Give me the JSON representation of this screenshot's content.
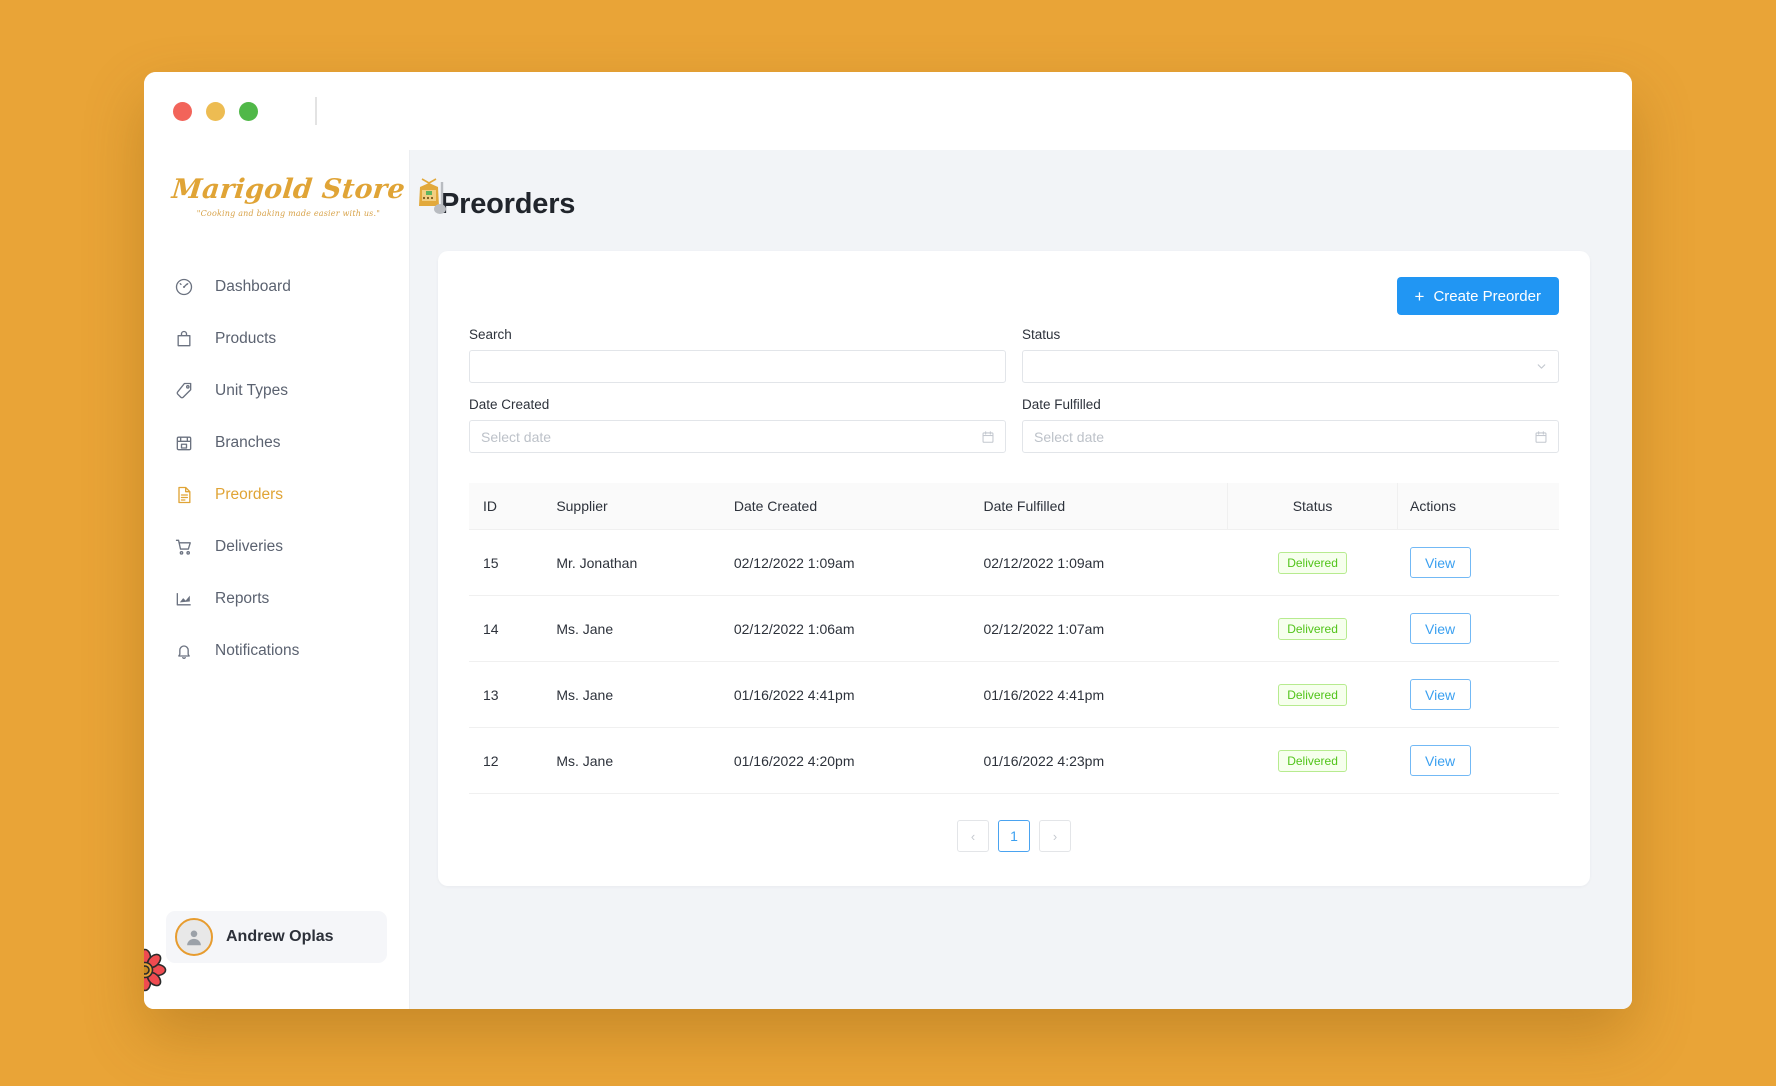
{
  "window": {
    "traffic_lights": [
      "close",
      "minimize",
      "maximize"
    ]
  },
  "sidebar": {
    "logo": {
      "name": "Marigold Store",
      "tagline": "\"Cooking and baking made easier with us.\""
    },
    "items": [
      {
        "label": "Dashboard",
        "icon": "speedometer-icon",
        "active": false
      },
      {
        "label": "Products",
        "icon": "bag-icon",
        "active": false
      },
      {
        "label": "Unit Types",
        "icon": "tag-icon",
        "active": false
      },
      {
        "label": "Branches",
        "icon": "store-icon",
        "active": false
      },
      {
        "label": "Preorders",
        "icon": "document-icon",
        "active": true
      },
      {
        "label": "Deliveries",
        "icon": "cart-icon",
        "active": false
      },
      {
        "label": "Reports",
        "icon": "chart-icon",
        "active": false
      },
      {
        "label": "Notifications",
        "icon": "bell-icon",
        "active": false
      }
    ],
    "profile": {
      "name": "Andrew Oplas",
      "avatar_icon": "user-avatar-icon"
    },
    "accent_color": "#e0a436"
  },
  "main": {
    "page_title": "Preorders",
    "create_button": {
      "label": "Create Preorder",
      "icon": "plus-icon",
      "color": "#2196f3"
    },
    "filters": {
      "search": {
        "label": "Search",
        "value": "",
        "placeholder": ""
      },
      "status": {
        "label": "Status",
        "value": "",
        "placeholder": "",
        "icon": "chevron-down-icon"
      },
      "date_created": {
        "label": "Date Created",
        "value": "",
        "placeholder": "Select date",
        "icon": "calendar-icon"
      },
      "date_fulfilled": {
        "label": "Date Fulfilled",
        "value": "",
        "placeholder": "Select date",
        "icon": "calendar-icon"
      }
    },
    "table": {
      "columns": [
        "ID",
        "Supplier",
        "Date Created",
        "Date Fulfilled",
        "Status",
        "Actions"
      ],
      "rows": [
        {
          "id": "15",
          "supplier": "Mr. Jonathan",
          "date_created": "02/12/2022 1:09am",
          "date_fulfilled": "02/12/2022 1:09am",
          "status": "Delivered",
          "action": "View"
        },
        {
          "id": "14",
          "supplier": "Ms. Jane",
          "date_created": "02/12/2022 1:06am",
          "date_fulfilled": "02/12/2022 1:07am",
          "status": "Delivered",
          "action": "View"
        },
        {
          "id": "13",
          "supplier": "Ms. Jane",
          "date_created": "01/16/2022 4:41pm",
          "date_fulfilled": "01/16/2022 4:41pm",
          "status": "Delivered",
          "action": "View"
        },
        {
          "id": "12",
          "supplier": "Ms. Jane",
          "date_created": "01/16/2022 4:20pm",
          "date_fulfilled": "01/16/2022 4:23pm",
          "status": "Delivered",
          "action": "View"
        }
      ]
    },
    "pagination": {
      "prev": "‹",
      "current": "1",
      "next": "›"
    }
  },
  "colors": {
    "page_background": "#e9a437",
    "content_background": "#f2f4f7",
    "accent": "#e0a436",
    "primary": "#2196f3",
    "success": "#52c41a"
  }
}
